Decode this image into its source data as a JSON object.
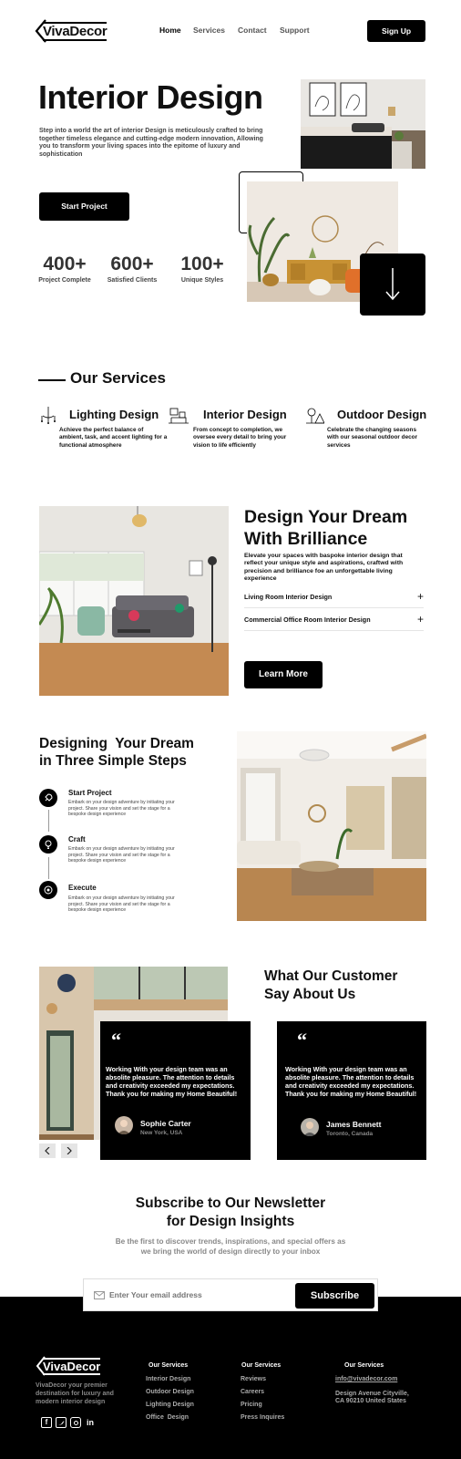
{
  "header": {
    "brand": "VivaDecor",
    "nav": [
      "Home",
      "Services",
      "Contact",
      "Support"
    ],
    "signup_label": "Sign Up"
  },
  "hero": {
    "title": "Interior Design",
    "description": "Step into a world the art of interior Design is meticulously crafted to bring together timeless elegance and cutting-edge modern innovation, Allowing you to transform your living spaces into the epitome of luxury and sophistication",
    "cta_label": "Start Project",
    "stats": [
      {
        "value": "400+",
        "label": "Project Complete"
      },
      {
        "value": "600+",
        "label": "Satisfied Clients"
      },
      {
        "value": "100+",
        "label": "Unique Styles"
      }
    ]
  },
  "services": {
    "title": "Our Services",
    "items": [
      {
        "icon": "chandelier-icon",
        "title": "Lighting Design",
        "desc": "Achieve the perfect balance of ambient, task, and accent lighting for a functional atmosphere"
      },
      {
        "icon": "interior-room-icon",
        "title": "Interior Design",
        "desc": "From concept to completion, we oversee every detail to bring your vision to life efficiently"
      },
      {
        "icon": "outdoor-tree-icon",
        "title": "Outdoor Design",
        "desc": "Celebrate the changing seasons with our seasonal outdoor decor services"
      }
    ]
  },
  "dream": {
    "title_line1": "Design Your Dream",
    "title_line2": "With Brilliance",
    "description": "Elevate your spaces with baspoke interior design that reflect your unique style and aspirations, craftwd with precision and brilliance foe an unforgettable living experience",
    "accordion": [
      "Living Room Interior Design",
      "Commercial Office Room Interior Design"
    ],
    "cta_label": "Learn More"
  },
  "steps": {
    "title_line1": "Designing  Your Dream",
    "title_line2": "in Three Simple Steps",
    "items": [
      {
        "icon": "rocket-icon",
        "title": "Start Project",
        "desc": "Embark on your design adventure by initiating your project. Share your vision and set the stage for a bespoke design experience"
      },
      {
        "icon": "lightbulb-icon",
        "title": "Craft",
        "desc": "Embark on your design adventure by initiating your project. Share your vision and set the stage for a bespoke design experience"
      },
      {
        "icon": "target-icon",
        "title": "Execute",
        "desc": "Embark on your design adventure by initiating your project. Share your vision and set the stage for a bespoke design experience"
      }
    ]
  },
  "testimonials": {
    "title_line1": "What Our Customer",
    "title_line2": "Say About Us",
    "items": [
      {
        "quote": "Working With your design team was an absolite pleasure. The attention to details and creativity exceeded  my expectations. Thank you for making my Home Beautiful!",
        "name": "Sophie Carter",
        "location": "New York, USA"
      },
      {
        "quote": "Working With your design team was an absolite pleasure. The attention to details and creativity exceeded  my expectations. Thank you for making my Home Beautiful!",
        "name": "James Bennett",
        "location": "Toronto, Canada"
      }
    ]
  },
  "newsletter": {
    "title_line1": "Subscribe to Our Newsletter",
    "title_line2": "for Design Insights",
    "desc_line1": "Be the first to discover trends, inspirations, and special offers as",
    "desc_line2": "we bring the world of design directly to your inbox",
    "placeholder": "Enter Your email address",
    "button_label": "Subscribe"
  },
  "footer": {
    "brand": "VivaDecor",
    "tagline": "VivaDecor your premier destination for luxury and modern interior design",
    "socials": [
      "facebook-icon",
      "twitter-icon",
      "instagram-icon",
      "linkedin-icon"
    ],
    "col1": {
      "heading": "Our Services",
      "links": [
        "Interior Design",
        "Outdoor Design",
        "Lighting Design",
        "Office  Design"
      ]
    },
    "col2": {
      "heading": "Our Services",
      "links": [
        "Reviews",
        "Careers",
        "Pricing",
        "Press Inquires"
      ]
    },
    "col3": {
      "heading": "Our Services",
      "email": "info@vivadecor.com",
      "address_line1": "Design Avenue Cityville,",
      "address_line2": "CA 90210 United States"
    }
  },
  "colors": {
    "primary": "#000000",
    "background": "#ffffff",
    "muted": "#888888"
  }
}
